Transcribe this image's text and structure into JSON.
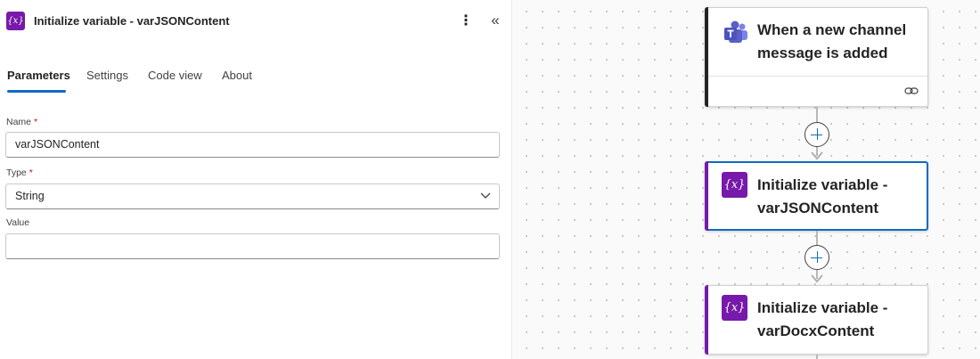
{
  "panel": {
    "title": "Initialize variable - varJSONContent",
    "header_icon": "variable-icon",
    "tabs": [
      {
        "label": "Parameters",
        "active": true
      },
      {
        "label": "Settings",
        "active": false
      },
      {
        "label": "Code view",
        "active": false
      },
      {
        "label": "About",
        "active": false
      }
    ],
    "fields": {
      "name": {
        "label": "Name",
        "required": "*",
        "value": "varJSONContent"
      },
      "type": {
        "label": "Type",
        "required": "*",
        "value": "String"
      },
      "value": {
        "label": "Value",
        "value": ""
      }
    }
  },
  "canvas": {
    "trigger_card": {
      "title_line1": "When a new channel",
      "title_line2": "message is added",
      "icon": "teams-icon",
      "footer_icon": "link-icon"
    },
    "action_cards": [
      {
        "title_line1": "Initialize variable -",
        "title_line2": "varJSONContent",
        "icon": "variable-icon",
        "selected": true
      },
      {
        "title_line1": "Initialize variable -",
        "title_line2": "varDocxContent",
        "icon": "variable-icon",
        "selected": false
      }
    ],
    "add_step_icon": "plus-icon"
  },
  "colors": {
    "accent_blue": "#0f6cbd",
    "variable_purple": "#7719aa",
    "required_red": "#c50f1f",
    "teams_purple": "#5b5fc7"
  }
}
